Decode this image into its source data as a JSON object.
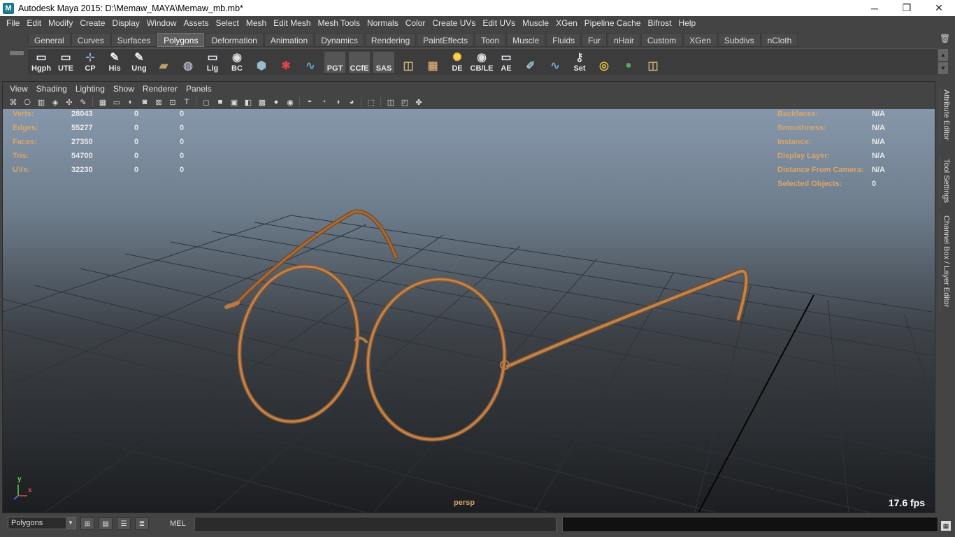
{
  "window": {
    "title": "Autodesk Maya 2015: D:\\Memaw_MAYA\\Memaw_mb.mb*",
    "minimize": "─",
    "restore": "❐",
    "close": "✕"
  },
  "menu": [
    "File",
    "Edit",
    "Modify",
    "Create",
    "Display",
    "Window",
    "Assets",
    "Select",
    "Mesh",
    "Edit Mesh",
    "Mesh Tools",
    "Normals",
    "Color",
    "Create UVs",
    "Edit UVs",
    "Muscle",
    "XGen",
    "Pipeline Cache",
    "Bifrost",
    "Help"
  ],
  "shelf": {
    "tabs": [
      "General",
      "Curves",
      "Surfaces",
      "Polygons",
      "Deformation",
      "Animation",
      "Dynamics",
      "Rendering",
      "PaintEffects",
      "Toon",
      "Muscle",
      "Fluids",
      "Fur",
      "nHair",
      "Custom",
      "XGen",
      "Subdivs",
      "nCloth"
    ],
    "active_tab": "Polygons",
    "icons": [
      {
        "label": "Hgph",
        "icon": "window-icon"
      },
      {
        "label": "UTE",
        "icon": "window-icon"
      },
      {
        "label": "CP",
        "icon": "axes-icon"
      },
      {
        "label": "His",
        "icon": "pencil-icon"
      },
      {
        "label": "Ung",
        "icon": "pencil-icon"
      },
      {
        "label": "",
        "icon": "book-icon"
      },
      {
        "label": "",
        "icon": "globe-icon"
      },
      {
        "label": "Lig",
        "icon": "window-icon"
      },
      {
        "label": "BC",
        "icon": "eye-icon"
      },
      {
        "label": "",
        "icon": "cube-icon"
      },
      {
        "label": "",
        "icon": "gear-icon"
      },
      {
        "label": "",
        "icon": "curve-icon"
      },
      {
        "label": "PGT",
        "icon": "blank-icon"
      },
      {
        "label": "CCfE",
        "icon": "blank-icon"
      },
      {
        "label": "SAS",
        "icon": "blank-icon"
      },
      {
        "label": "",
        "icon": "uv-icon"
      },
      {
        "label": "",
        "icon": "grid-icon"
      },
      {
        "label": "DE",
        "icon": "light-icon"
      },
      {
        "label": "CB/LE",
        "icon": "eye-icon"
      },
      {
        "label": "AE",
        "icon": "window-icon"
      },
      {
        "label": "",
        "icon": "brush-icon"
      },
      {
        "label": "",
        "icon": "curve-icon"
      },
      {
        "label": "Set",
        "icon": "key-icon"
      },
      {
        "label": "",
        "icon": "target-icon"
      },
      {
        "label": "",
        "icon": "sphere-icon"
      },
      {
        "label": "",
        "icon": "uv-icon"
      }
    ]
  },
  "panel": {
    "menu": [
      "View",
      "Shading",
      "Lighting",
      "Show",
      "Renderer",
      "Panels"
    ]
  },
  "hud": {
    "left": [
      {
        "label": "Verts:",
        "v1": "28043",
        "v2": "0",
        "v3": "0"
      },
      {
        "label": "Edges:",
        "v1": "55277",
        "v2": "0",
        "v3": "0"
      },
      {
        "label": "Faces:",
        "v1": "27350",
        "v2": "0",
        "v3": "0"
      },
      {
        "label": "Tris:",
        "v1": "54700",
        "v2": "0",
        "v3": "0"
      },
      {
        "label": "UVs:",
        "v1": "32230",
        "v2": "0",
        "v3": "0"
      }
    ],
    "right": [
      {
        "label": "Backfaces:",
        "value": "N/A"
      },
      {
        "label": "Smoothness:",
        "value": "N/A"
      },
      {
        "label": "Instance:",
        "value": "N/A"
      },
      {
        "label": "Display Layer:",
        "value": "N/A"
      },
      {
        "label": "Distance From Camera:",
        "value": "N/A"
      },
      {
        "label": "Selected Objects:",
        "value": "0"
      }
    ],
    "camera": "persp",
    "fps": "17.6 fps",
    "axis_y": "y",
    "axis_x": "x"
  },
  "dock": {
    "tabs": [
      "Attribute Editor",
      "Tool Settings",
      "Channel Box / Layer Editor"
    ]
  },
  "cmd": {
    "mode": "Polygons",
    "mel": "MEL"
  },
  "colors": {
    "hud_label": "#d9a56a",
    "glasses": "#b67a46"
  }
}
